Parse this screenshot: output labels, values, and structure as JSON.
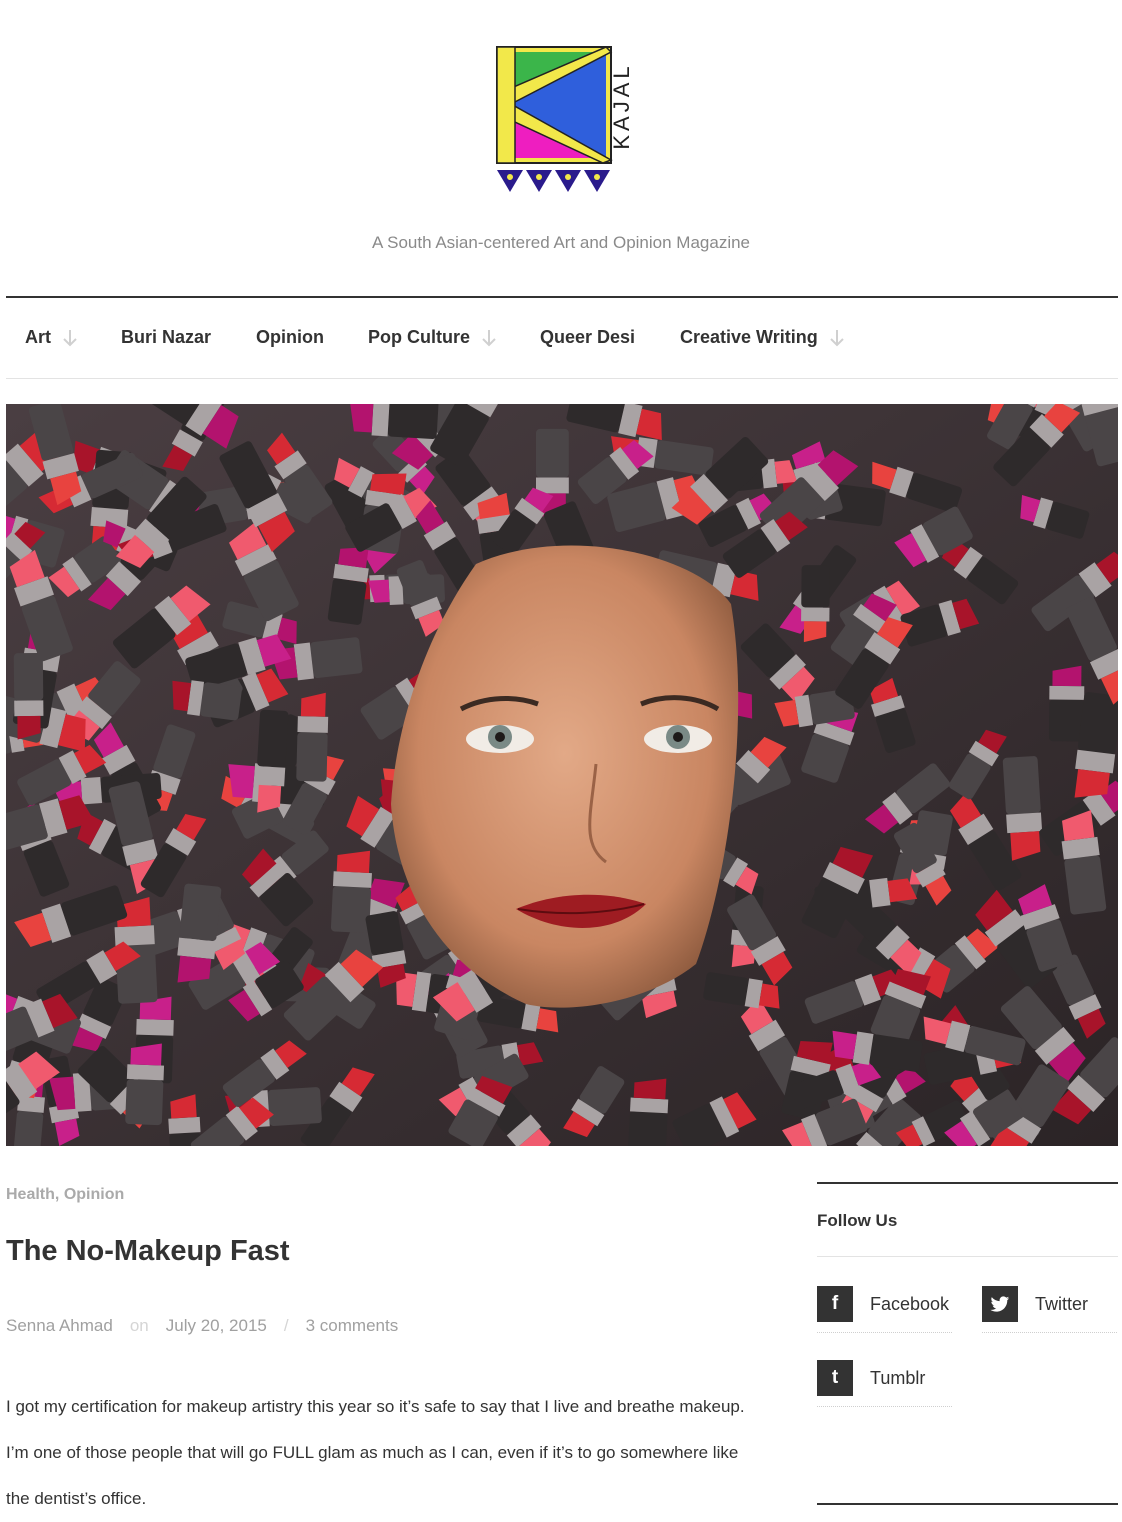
{
  "site": {
    "logo_text": "KAJAL",
    "tagline": "A South Asian-centered Art and Opinion Magazine"
  },
  "nav": {
    "items": [
      {
        "label": "Art",
        "has_dropdown": true
      },
      {
        "label": "Buri Nazar",
        "has_dropdown": false
      },
      {
        "label": "Opinion",
        "has_dropdown": false
      },
      {
        "label": "Pop Culture",
        "has_dropdown": true
      },
      {
        "label": "Queer Desi",
        "has_dropdown": false
      },
      {
        "label": "Creative Writing",
        "has_dropdown": true
      }
    ]
  },
  "article": {
    "categories": [
      "Health",
      "Opinion"
    ],
    "category_separator": ",",
    "title": "The No-Makeup Fast",
    "author": "Senna Ahmad",
    "meta_on": "on",
    "date": "July 20, 2015",
    "meta_sep": "/",
    "comments": "3 comments",
    "body": "I got my certification for makeup artistry this year so it’s safe to say that I live and breathe makeup. I’m one of those people that will go FULL glam as much as I can, even if it’s to go somewhere like the dentist’s office."
  },
  "sidebar": {
    "follow_title": "Follow Us",
    "social": [
      {
        "label": "Facebook",
        "icon": "facebook-icon",
        "glyph": "f"
      },
      {
        "label": "Twitter",
        "icon": "twitter-icon",
        "glyph": ""
      },
      {
        "label": "Tumblr",
        "icon": "tumblr-icon",
        "glyph": "t"
      }
    ]
  },
  "colors": {
    "text_dark": "#333333",
    "text_muted": "#8a8a8a",
    "logo_green": "#3bb54a",
    "logo_blue": "#2f5fdc",
    "logo_magenta": "#ee1ec0",
    "logo_yellow": "#f2e84a",
    "logo_indigo": "#2a1b8c"
  }
}
